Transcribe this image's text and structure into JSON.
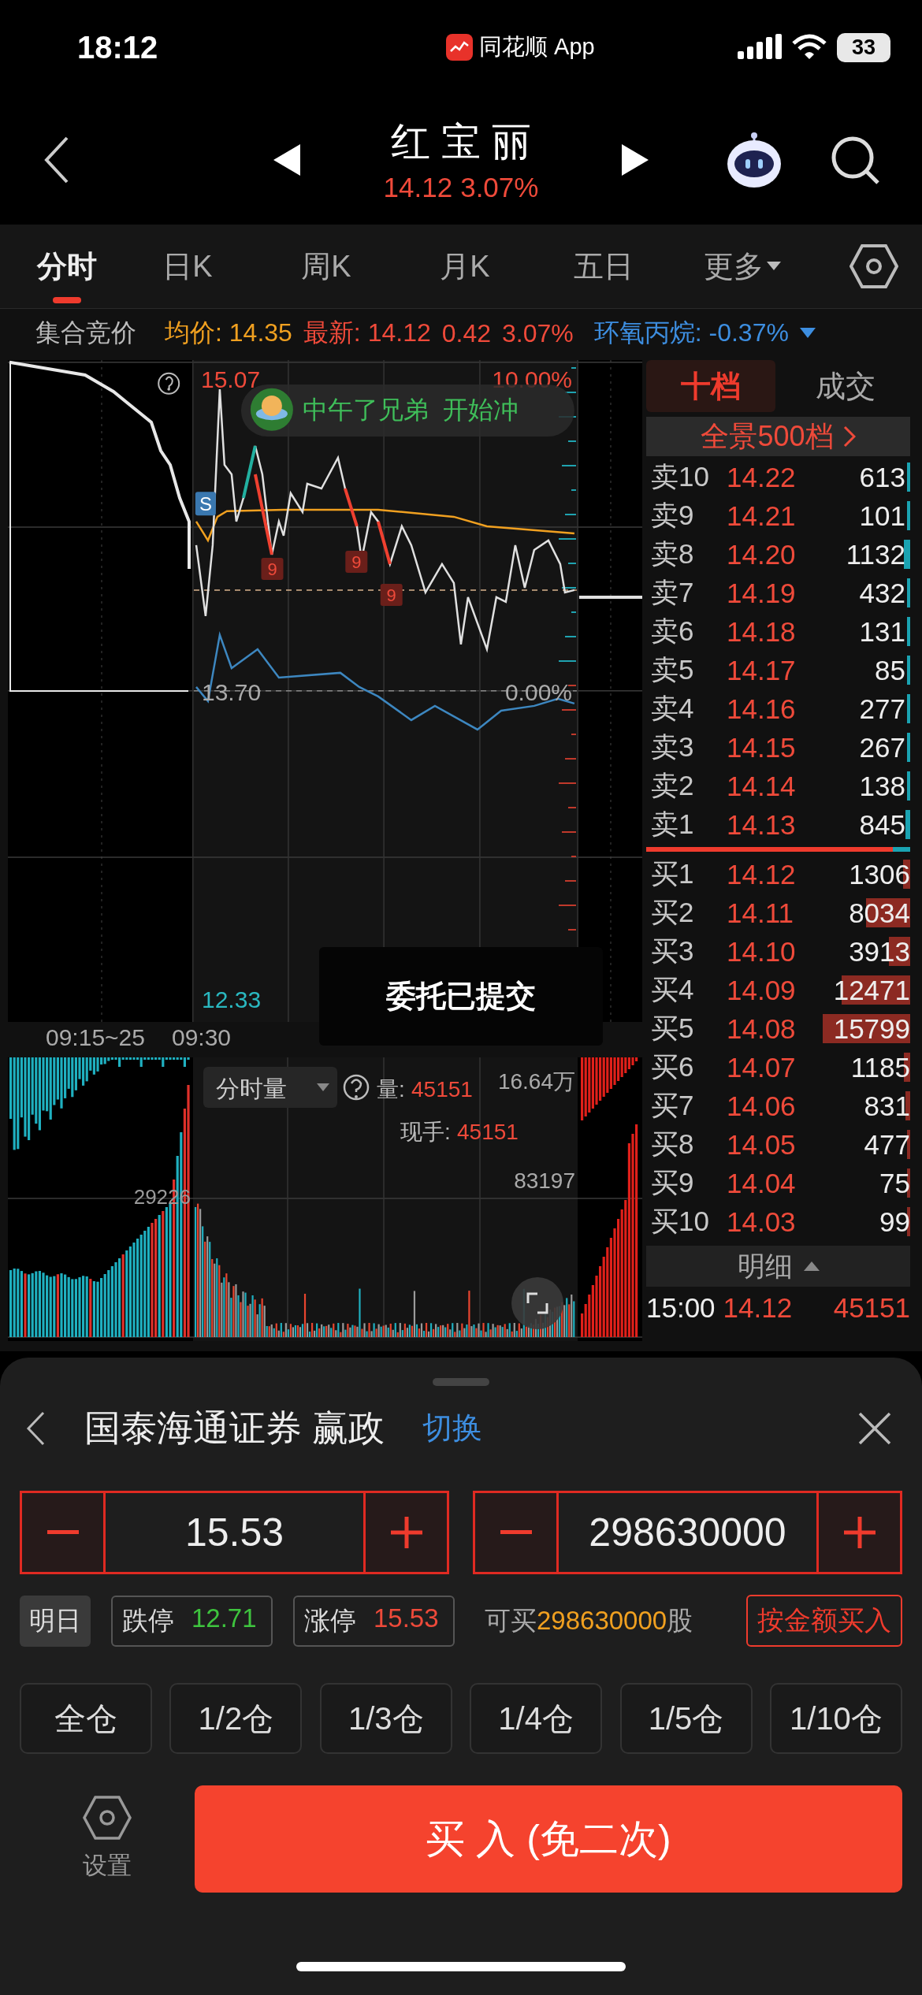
{
  "status_bar": {
    "time": "18:12",
    "app_label": "同花顺 App",
    "battery": "33"
  },
  "header": {
    "title": "红 宝 丽",
    "price": "14.12",
    "change": "3.07%"
  },
  "tabs": [
    {
      "label": "分时",
      "selected": true,
      "dropdown": false
    },
    {
      "label": "日K",
      "selected": false,
      "dropdown": false
    },
    {
      "label": "周K",
      "selected": false,
      "dropdown": false
    },
    {
      "label": "月K",
      "selected": false,
      "dropdown": false
    },
    {
      "label": "五日",
      "selected": false,
      "dropdown": false
    },
    {
      "label": "更多",
      "selected": false,
      "dropdown": true
    }
  ],
  "info_bar": {
    "session": "集合竞价",
    "avg_label": "均价:",
    "avg": "14.35",
    "last_label": "最新:",
    "last": "14.12",
    "change": "0.42",
    "change_pct": "3.07%",
    "sector": "环氧丙烷:",
    "sector_change": "-0.37%"
  },
  "price_chart": {
    "high": "15.07",
    "high_pct": "10.00%",
    "base": "13.70",
    "base_pct": "0.00%",
    "low": "12.33",
    "times": [
      "09:15~25",
      "09:30"
    ],
    "bubble": "中午了兄弟  开始冲",
    "markers": [
      {
        "kind": "sell",
        "label": "S"
      },
      {
        "kind": "nine",
        "label": "9"
      },
      {
        "kind": "nine",
        "label": "9"
      },
      {
        "kind": "nine",
        "label": "9"
      }
    ]
  },
  "volume_chart": {
    "selector": "分时量",
    "volume_label": "量:",
    "volume": "45151",
    "total": "16.64万",
    "hand_label": "现手:",
    "hand": "45151",
    "max_main": "83197",
    "max_auction": "29226"
  },
  "toast": "委托已提交",
  "order_book": {
    "tabs": [
      {
        "label": "十档",
        "selected": true
      },
      {
        "label": "成交",
        "selected": false
      }
    ],
    "panorama": "全景500档",
    "asks": [
      {
        "label": "卖10",
        "price": "14.22",
        "volume": "613"
      },
      {
        "label": "卖9",
        "price": "14.21",
        "volume": "101"
      },
      {
        "label": "卖8",
        "price": "14.20",
        "volume": "1132"
      },
      {
        "label": "卖7",
        "price": "14.19",
        "volume": "432"
      },
      {
        "label": "卖6",
        "price": "14.18",
        "volume": "131"
      },
      {
        "label": "卖5",
        "price": "14.17",
        "volume": "85"
      },
      {
        "label": "卖4",
        "price": "14.16",
        "volume": "277"
      },
      {
        "label": "卖3",
        "price": "14.15",
        "volume": "267"
      },
      {
        "label": "卖2",
        "price": "14.14",
        "volume": "138"
      },
      {
        "label": "卖1",
        "price": "14.13",
        "volume": "845"
      }
    ],
    "bids": [
      {
        "label": "买1",
        "price": "14.12",
        "volume": "1306"
      },
      {
        "label": "买2",
        "price": "14.11",
        "volume": "8034"
      },
      {
        "label": "买3",
        "price": "14.10",
        "volume": "3913"
      },
      {
        "label": "买4",
        "price": "14.09",
        "volume": "12471"
      },
      {
        "label": "买5",
        "price": "14.08",
        "volume": "15799"
      },
      {
        "label": "买6",
        "price": "14.07",
        "volume": "1185"
      },
      {
        "label": "买7",
        "price": "14.06",
        "volume": "831"
      },
      {
        "label": "买8",
        "price": "14.05",
        "volume": "477"
      },
      {
        "label": "买9",
        "price": "14.04",
        "volume": "75"
      },
      {
        "label": "买10",
        "price": "14.03",
        "volume": "99"
      }
    ],
    "detail_button": "明细",
    "last_trade": {
      "time": "15:00",
      "price": "14.12",
      "volume": "45151"
    }
  },
  "order_panel": {
    "broker": "国泰海通证券 赢政",
    "switch": "切换",
    "price": "15.53",
    "quantity": "298630000",
    "day": "明日",
    "limit_down_label": "跌停",
    "limit_down": "12.71",
    "limit_up_label": "涨停",
    "limit_up": "15.53",
    "buyable_prefix": "可买",
    "buyable": "298630000",
    "buyable_suffix": "股",
    "amount_button": "按金额买入",
    "positions": [
      "全仓",
      "1/2仓",
      "1/3仓",
      "1/4仓",
      "1/5仓",
      "1/10仓"
    ],
    "settings": "设置",
    "buy_button": "买 入 (免二次)"
  }
}
